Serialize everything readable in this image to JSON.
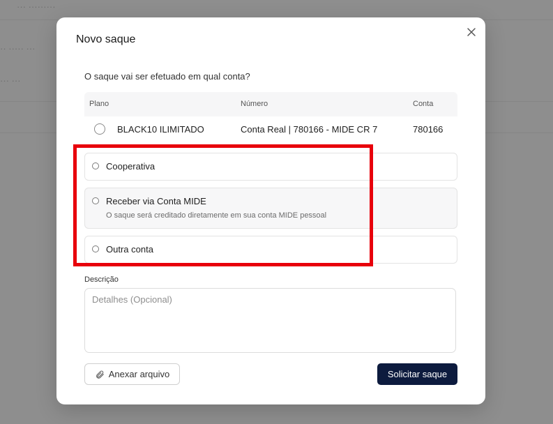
{
  "background": {
    "blurred_text_1": "··· ·········",
    "blurred_text_2": "·· ····· ···",
    "blurred_text_3": "··· ···"
  },
  "modal": {
    "title": "Novo saque",
    "close_icon": "close-icon",
    "question": "O saque vai ser efetuado em qual conta?"
  },
  "table": {
    "headers": [
      "Plano",
      "Número",
      "Conta"
    ],
    "rows": [
      {
        "plano": "BLACK10 ILIMITADO",
        "numero": "Conta Real | 780166 - MIDE CR 7",
        "conta": "780166"
      }
    ]
  },
  "options": [
    {
      "label": "Cooperativa",
      "sublabel": ""
    },
    {
      "label": "Receber via Conta MIDE",
      "sublabel": "O saque será creditado diretamente em sua conta MIDE pessoal"
    },
    {
      "label": "Outra conta",
      "sublabel": ""
    }
  ],
  "description": {
    "label": "Descrição",
    "placeholder": "Detalhes (Opcional)",
    "value": ""
  },
  "buttons": {
    "attach_label": "Anexar arquivo",
    "attach_icon": "paperclip-icon",
    "submit_label": "Solicitar saque"
  },
  "colors": {
    "primary": "#0d1b3e",
    "highlight": "#e8000b",
    "overlay": "#8e8e8e"
  }
}
